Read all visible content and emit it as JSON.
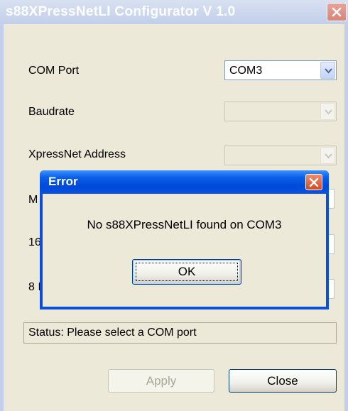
{
  "main_window": {
    "title": "s88XPressNetLI Configurator V 1.0",
    "labels": {
      "com_port": "COM Port",
      "baudrate": "Baudrate",
      "xpressnet_address": "XpressNet Address",
      "row4_partial": "M",
      "row5_partial": "16",
      "row6_partial": "8 I"
    },
    "com_port_value": "COM3",
    "status": "Status: Please select a COM port",
    "apply_label": "Apply",
    "close_label": "Close"
  },
  "dialog": {
    "title": "Error",
    "message": "No s88XPressNetLI found on COM3",
    "ok_label": "OK"
  },
  "icons": {
    "close": "close-icon",
    "dropdown": "chevron-down-icon"
  },
  "colors": {
    "dialog_title_blue": "#0054e3",
    "close_red": "#d7491f",
    "window_face": "#ece9d8"
  }
}
